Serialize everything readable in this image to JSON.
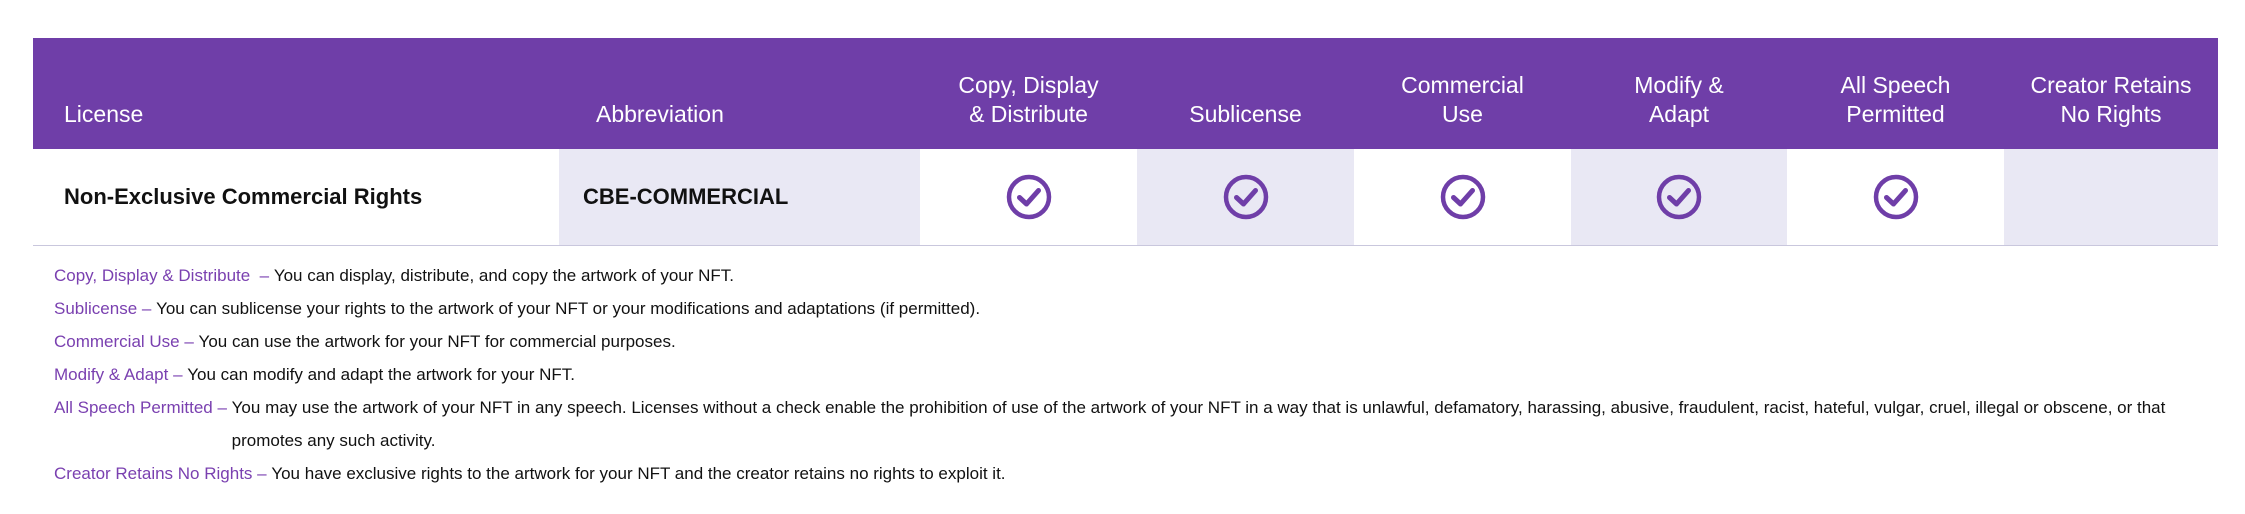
{
  "colors": {
    "header_bg": "#6f3ea8",
    "accent_purple": "#6f3ea8",
    "shaded_cell": "#e9e8f4",
    "term_text": "#7a40b0"
  },
  "table": {
    "headers": [
      "License",
      "Abbreviation",
      "Copy, Display\n& Distribute",
      "Sublicense",
      "Commercial\nUse",
      "Modify &\nAdapt",
      "All Speech\nPermitted",
      "Creator Retains\nNo Rights"
    ],
    "row": {
      "license": "Non-Exclusive Commercial Rights",
      "abbreviation": "CBE-COMMERCIAL",
      "checks": [
        true,
        true,
        true,
        true,
        true,
        false
      ],
      "check_icon": "check-circle-icon"
    }
  },
  "definitions": [
    {
      "term": "Copy, Display & Distribute  – ",
      "text": "You can display, distribute, and copy the artwork of your NFT."
    },
    {
      "term": "Sublicense – ",
      "text": "You can sublicense your rights to the artwork of your NFT or your modifications and adaptations (if permitted)."
    },
    {
      "term": "Commercial Use – ",
      "text": "You can use the artwork for your NFT for commercial purposes."
    },
    {
      "term": "Modify & Adapt – ",
      "text": "You can modify and adapt the artwork for your NFT."
    },
    {
      "term": "All Speech Permitted – ",
      "text": "You may use the artwork of your NFT in any speech.  Licenses without a check enable the prohibition of  use of the artwork of your NFT in a way that is unlawful, defamatory, harassing, abusive, fraudulent, racist, hateful, vulgar, cruel, illegal or obscene, or that promotes any such activity."
    },
    {
      "term": "Creator Retains No Rights – ",
      "text": "You have exclusive rights to the artwork for your NFT and the creator retains no rights to exploit it."
    }
  ]
}
